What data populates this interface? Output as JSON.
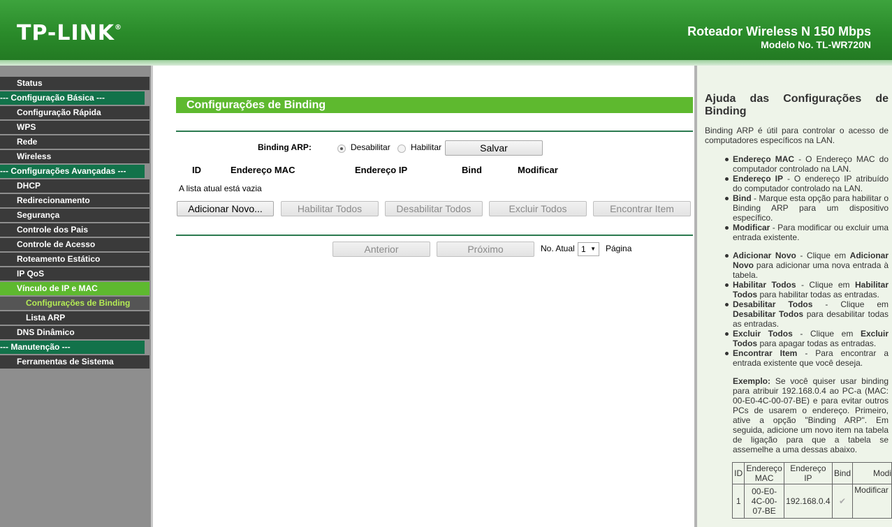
{
  "header": {
    "logo": "TP-LINK",
    "product_title": "Roteador Wireless N 150 Mbps",
    "model": "Modelo No. TL-WR720N"
  },
  "sidebar": {
    "items": [
      {
        "label": "Status"
      },
      {
        "label": "--- Configuração Básica ---"
      },
      {
        "label": "Configuração Rápida"
      },
      {
        "label": "WPS"
      },
      {
        "label": "Rede"
      },
      {
        "label": "Wireless"
      },
      {
        "label": "--- Configurações Avançadas ---"
      },
      {
        "label": "DHCP"
      },
      {
        "label": "Redirecionamento"
      },
      {
        "label": "Segurança"
      },
      {
        "label": "Controle dos Pais"
      },
      {
        "label": "Controle de Acesso"
      },
      {
        "label": "Roteamento Estático"
      },
      {
        "label": "IP QoS"
      },
      {
        "label": "Vínculo de IP e MAC"
      },
      {
        "label": "Configurações de Binding"
      },
      {
        "label": "Lista ARP"
      },
      {
        "label": "DNS Dinâmico"
      },
      {
        "label": "--- Manutenção ---"
      },
      {
        "label": "Ferramentas de Sistema"
      }
    ]
  },
  "main": {
    "title": "Configurações de Binding",
    "arp_label": "Binding ARP:",
    "radio_disable": "Desabilitar",
    "radio_enable": "Habilitar",
    "arp_selected": "Desabilitar",
    "save_button": "Salvar",
    "columns": [
      "ID",
      "Endereço MAC",
      "Endereço IP",
      "Bind",
      "Modificar"
    ],
    "empty_message": "A lista atual está vazia",
    "add_button": "Adicionar Novo...",
    "enable_all_button": "Habilitar Todos",
    "disable_all_button": "Desabilitar Todos",
    "delete_all_button": "Excluir Todos",
    "find_button": "Encontrar Item",
    "prev_button": "Anterior",
    "next_button": "Próximo",
    "current_page_label": "No. Atual",
    "current_page": "1",
    "page_label": "Página"
  },
  "help": {
    "title_line1": "Ajuda das Configurações de",
    "title_line2": "Binding",
    "intro": "Binding ARP é útil para controlar o acesso de computadores específicos na LAN.",
    "list1": [
      {
        "term": "Endereço MAC",
        "text": " - O Endereço MAC do computador controlado na LAN."
      },
      {
        "term": "Endereço IP",
        "text": " - O endereço IP atribuído do computador controlado na LAN."
      },
      {
        "term": "Bind",
        "text": " - Marque esta opção para habilitar o Binding ARP para um dispositivo específico."
      },
      {
        "term": "Modificar",
        "text": " - Para modificar ou excluir uma entrada existente."
      }
    ],
    "list2": [
      {
        "term": "Adicionar Novo",
        "mid": " - Clique em ",
        "term2": "Adicionar Novo",
        "text": " para adicionar uma nova entrada à tabela."
      },
      {
        "term": "Habilitar Todos",
        "mid": " - Clique em ",
        "term2": "Habilitar Todos",
        "text": " para habilitar todas as entradas."
      },
      {
        "term": "Desabilitar Todos",
        "mid": " - Clique em ",
        "term2": "Desabilitar Todos",
        "text": " para desabilitar todas as entradas."
      },
      {
        "term": "Excluir Todos",
        "mid": " - Clique em ",
        "term2": "Excluir Todos",
        "text": " para apagar todas as entradas."
      },
      {
        "term": "Encontrar Item",
        "mid": " - Para encontrar a entrada existente que você deseja.",
        "term2": "",
        "text": ""
      }
    ],
    "example_label": "Exemplo:",
    "example_text": " Se você quiser usar binding para atribuir 192.168.0.4 ao PC-a (MAC: 00-E0-4C-00-07-BE) e para evitar outros PCs de usarem o endereço. Primeiro, ative a opção \"Binding ARP\". Em seguida, adicione um novo item na tabela de ligação para que a tabela se assemelhe a uma dessas abaixo.",
    "table": {
      "headers": [
        "ID",
        "Endereço MAC",
        "Endereço IP",
        "Bind",
        "Modi"
      ],
      "row": {
        "id": "1",
        "mac": "00-E0-4C-00-07-BE",
        "ip": "192.168.0.4",
        "bind": "✔",
        "modify": "Modificar"
      }
    }
  }
}
